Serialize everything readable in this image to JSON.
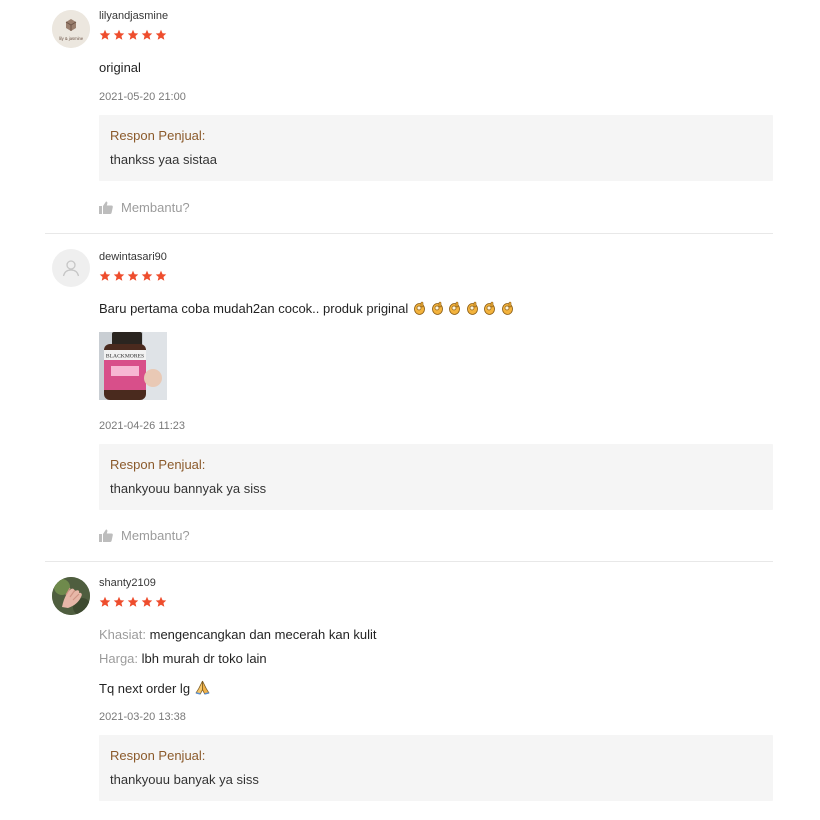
{
  "reviews": [
    {
      "username": "lilyandjasmine",
      "rating": 5,
      "comment": "original",
      "time": "2021-05-20 21:00",
      "reply_title": "Respon Penjual:",
      "reply_text": "thankss yaa sistaa",
      "helpful_label": "Membantu?",
      "avatar_text": "lily & jasmine"
    },
    {
      "username": "dewintasari90",
      "rating": 5,
      "comment": "Baru pertama coba mudah2an cocok.. produk priginal",
      "time": "2021-04-26 11:23",
      "reply_title": "Respon Penjual:",
      "reply_text": "thankyouu bannyak ya siss",
      "helpful_label": "Membantu?",
      "photo_label": "BLACKMORES"
    },
    {
      "username": "shanty2109",
      "rating": 5,
      "attributes": [
        {
          "label": "Khasiat:",
          "value": "mengencangkan dan mecerah kan kulit"
        },
        {
          "label": "Harga:",
          "value": "lbh murah dr toko lain"
        }
      ],
      "comment": "Tq next order lg",
      "time": "2021-03-20 13:38",
      "reply_title": "Respon Penjual:",
      "reply_text": "thankyouu banyak ya siss"
    }
  ],
  "icons": {
    "star": "star-icon",
    "thumb": "thumbs-up-icon",
    "ok_hand": "ok-hand-emoji",
    "pray": "folded-hands-emoji",
    "default_avatar": "user-icon"
  },
  "colors": {
    "star": "#ee4d2d",
    "reply_title": "#8b5a2b",
    "reply_bg": "#f5f5f5"
  }
}
